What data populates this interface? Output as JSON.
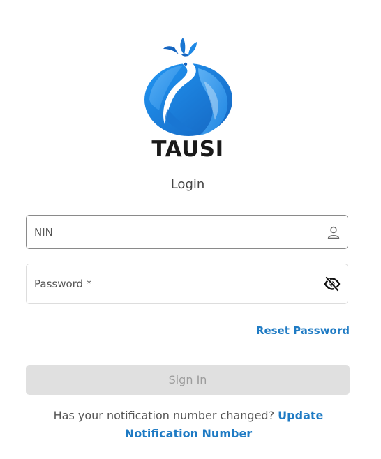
{
  "brand": {
    "name": "TAUSI",
    "logo_icon": "tausi-peacock-logo-icon"
  },
  "page": {
    "subtitle": "Login"
  },
  "form": {
    "nin": {
      "placeholder": "NIN",
      "value": "",
      "icon": "user-icon"
    },
    "password": {
      "placeholder": "Password *",
      "value": "",
      "icon": "eye-off-icon"
    },
    "reset_password_label": "Reset Password",
    "sign_in_label": "Sign In",
    "sign_in_enabled": false
  },
  "footer": {
    "question": "Has your notification number changed?",
    "link_label": "Update Notification Number"
  },
  "colors": {
    "link": "#1f7bc4",
    "button_disabled_bg": "#e0e0e0",
    "button_disabled_text": "#9c9c9c",
    "logo_blue": "#1e88e5"
  }
}
